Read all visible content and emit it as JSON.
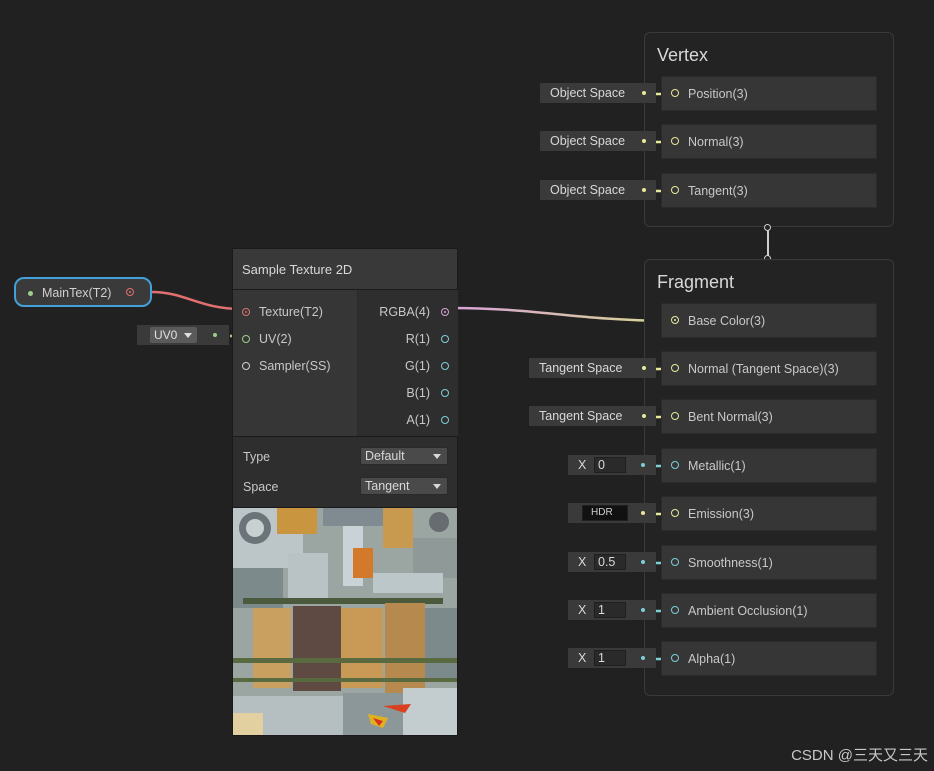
{
  "property_node": {
    "label": "MainTex(T2)"
  },
  "uv_dropdown": {
    "value": "UV0"
  },
  "sample_texture": {
    "title": "Sample Texture 2D",
    "inputs": [
      {
        "label": "Texture(T2)"
      },
      {
        "label": "UV(2)"
      },
      {
        "label": "Sampler(SS)"
      }
    ],
    "outputs": [
      {
        "label": "RGBA(4)"
      },
      {
        "label": "R(1)"
      },
      {
        "label": "G(1)"
      },
      {
        "label": "B(1)"
      },
      {
        "label": "A(1)"
      }
    ],
    "settings": [
      {
        "label": "Type",
        "value": "Default"
      },
      {
        "label": "Space",
        "value": "Tangent"
      }
    ]
  },
  "vertex": {
    "title": "Vertex",
    "slots": [
      {
        "label": "Position(3)",
        "input": "Object Space"
      },
      {
        "label": "Normal(3)",
        "input": "Object Space"
      },
      {
        "label": "Tangent(3)",
        "input": "Object Space"
      }
    ]
  },
  "fragment": {
    "title": "Fragment",
    "slots": [
      {
        "label": "Base Color(3)",
        "input": ""
      },
      {
        "label": "Normal (Tangent Space)(3)",
        "input": "Tangent Space"
      },
      {
        "label": "Bent Normal(3)",
        "input": "Tangent Space"
      },
      {
        "label": "Metallic(1)",
        "input_prefix": "X",
        "input": "0"
      },
      {
        "label": "Emission(3)",
        "input": "HDR"
      },
      {
        "label": "Smoothness(1)",
        "input_prefix": "X",
        "input": "0.5"
      },
      {
        "label": "Ambient Occlusion(1)",
        "input_prefix": "X",
        "input": "1"
      },
      {
        "label": "Alpha(1)",
        "input_prefix": "X",
        "input": "1"
      }
    ]
  },
  "watermark": "CSDN @三天又三天",
  "colors": {
    "background": "#212121",
    "selection": "#44a0d8",
    "texture_port": "#e07070",
    "vector3_port": "#e8e89a",
    "float_port": "#7ccfd8",
    "vector2_port": "#9ecf8a",
    "vector4_port": "#d8a0d8"
  }
}
